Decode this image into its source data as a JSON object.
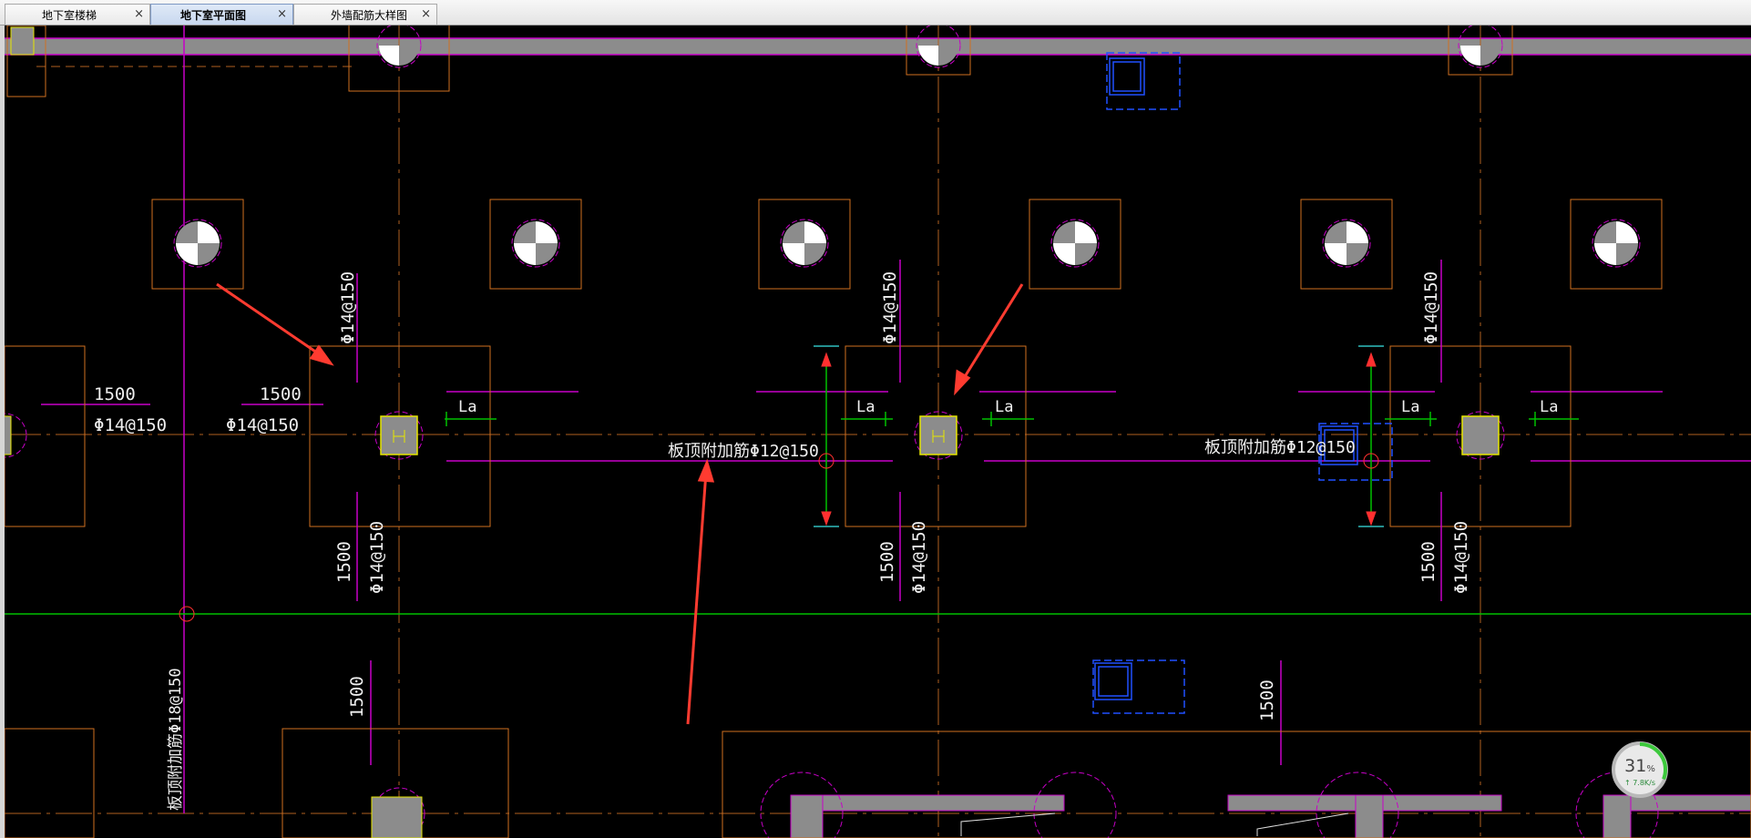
{
  "tabs": [
    {
      "label": "地下室楼梯",
      "active": false
    },
    {
      "label": "地下室平面图",
      "active": true
    },
    {
      "label": "外墙配筋大样图",
      "active": false
    }
  ],
  "tab_close_glyph": "×",
  "drawing": {
    "dim_1500": "1500",
    "rebar_d14": "Φ14@150",
    "lap_la": "La",
    "slab_top_rebar": "板顶附加筋Φ12@150",
    "slab_top_rebar_d18": "板顶附加筋Φ18@150"
  },
  "speed_widget": {
    "percent": "31",
    "percent_unit": "%",
    "percent_value": 31,
    "rate": "↑ 7.8K/s"
  },
  "colors": {
    "background": "#000000",
    "beam_gray": "#8c8c8c",
    "magenta": "#c800c8",
    "orange_axis": "#b06020",
    "green_line": "#00c000",
    "red_arrow": "#ff3b30",
    "yellow_column": "#e6e600",
    "blue_object": "#2050ff"
  },
  "icons": [
    "close-icon",
    "arrow-annotation-icon",
    "column-symbol-icon"
  ]
}
